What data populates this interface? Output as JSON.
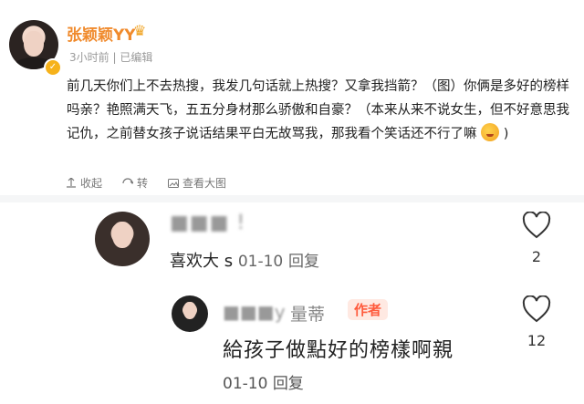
{
  "post": {
    "author": "张颖颖YY",
    "timestamp": "3小时前",
    "edited": "已编辑",
    "text": "前几天你们上不去热搜，我发几句话就上热搜？又拿我挡箭？（图）你俩是多好的榜样吗亲？艳照满天飞，五五分身材那么骄傲和自豪？（本来从来不说女生，但不好意思我记仇，之前替女孩子说话结果平白无故骂我，那我看个笑话还不行了嘛",
    "text_end": ")",
    "actions": {
      "collect": "收起",
      "repost": "转",
      "view_image": "查看大图"
    }
  },
  "comment": {
    "username_masked": "■■■ !",
    "text": "喜欢大 s",
    "date": "01-10",
    "reply_label": "回复",
    "likes": "2"
  },
  "reply": {
    "username_masked": "■■■y",
    "username_tail": "量蒂",
    "badge": "作者",
    "text": "給孩子做點好的榜樣啊親",
    "date": "01-10",
    "reply_label": "回复",
    "likes": "12"
  },
  "colors": {
    "name": "#f08a2c",
    "badge": "#ff5a3c",
    "badge_bg": "#ffe9e2"
  },
  "icons": [
    "verified-icon",
    "crown-icon",
    "collect-icon",
    "repost-icon",
    "image-icon",
    "heart-icon"
  ]
}
